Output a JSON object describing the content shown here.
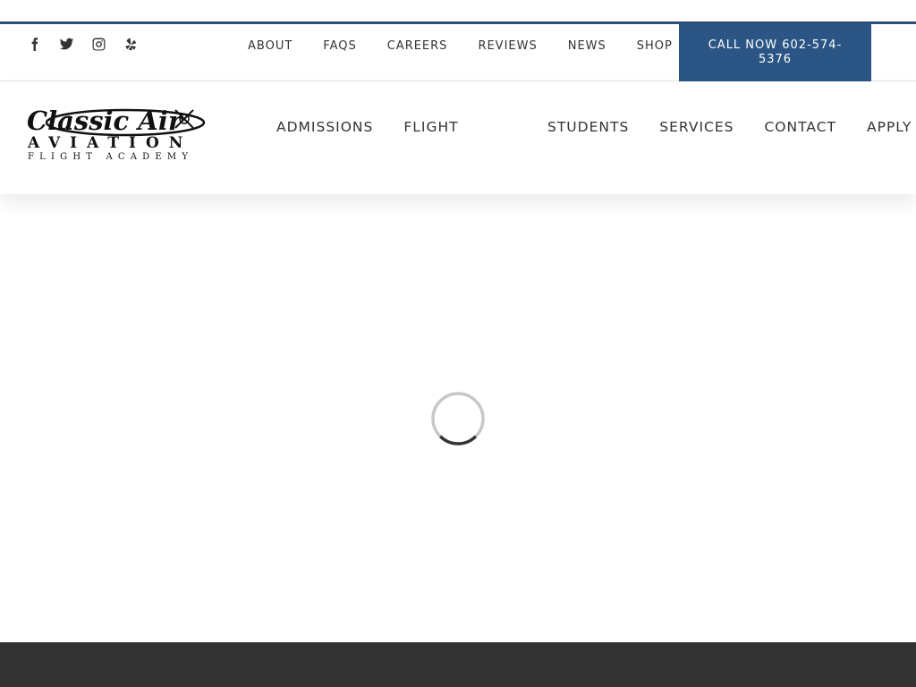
{
  "colors": {
    "accent": "#2b5584",
    "top_border": "#2b5078",
    "footer": "#333333",
    "text": "#333333"
  },
  "social": [
    {
      "name": "facebook-icon"
    },
    {
      "name": "twitter-icon"
    },
    {
      "name": "instagram-icon"
    },
    {
      "name": "yelp-icon"
    }
  ],
  "top_nav": {
    "about": "ABOUT",
    "faqs": "FAQS",
    "careers": "CAREERS",
    "reviews": "REVIEWS",
    "news": "NEWS",
    "shop": "SHOP"
  },
  "call_button": {
    "line1": "CALL NOW 602-574-",
    "line2": "5376"
  },
  "logo": {
    "line1": "Classic Air",
    "line2": "AVIATION",
    "line3": "FLIGHT ACADEMY"
  },
  "main_nav": {
    "admissions": "ADMISSIONS",
    "flight": "FLIGHT",
    "students": "STUDENTS",
    "services": "SERVICES",
    "contact": "CONTACT",
    "apply": "APPLY"
  },
  "loader": {
    "icon": "loading-spinner-icon"
  }
}
